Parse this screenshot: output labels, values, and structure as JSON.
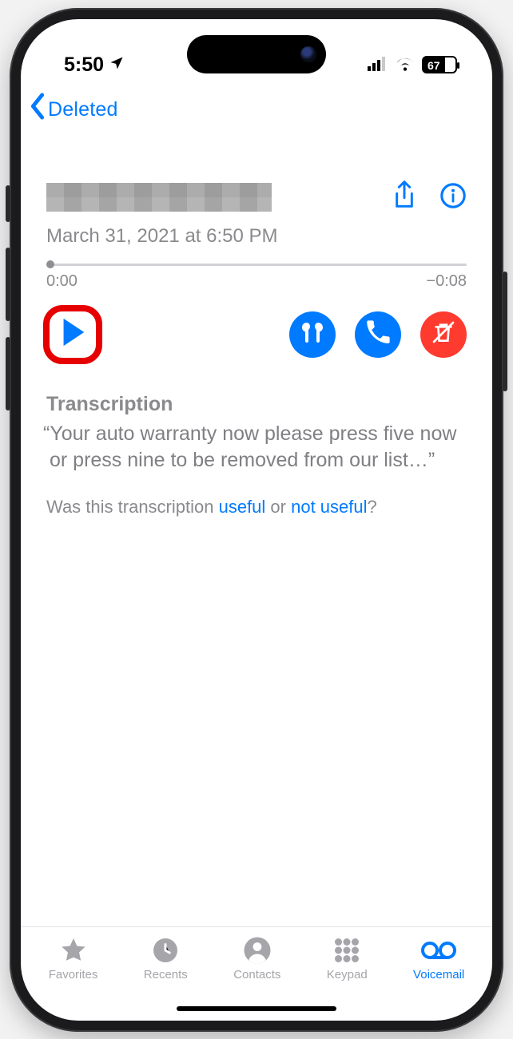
{
  "status": {
    "time": "5:50",
    "battery_pct": "67"
  },
  "nav": {
    "back_label": "Deleted"
  },
  "voicemail": {
    "timestamp": "March 31, 2021 at 6:50 PM",
    "elapsed": "0:00",
    "remaining": "−0:08"
  },
  "transcription": {
    "title": "Transcription",
    "body": "Your auto warranty now please press five now or press nine to be removed from our list",
    "feedback_prefix": "Was this transcription ",
    "useful": "useful",
    "or": " or ",
    "not_useful": "not useful",
    "q": "?"
  },
  "tabs": {
    "favorites": "Favorites",
    "recents": "Recents",
    "contacts": "Contacts",
    "keypad": "Keypad",
    "voicemail": "Voicemail"
  }
}
